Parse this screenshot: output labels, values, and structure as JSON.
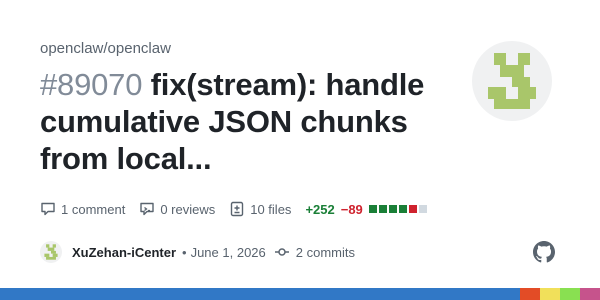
{
  "repo": "openclaw/openclaw",
  "pr": {
    "number": "#89070",
    "title": "fix(stream): handle cumulative JSON chunks from local..."
  },
  "stats": {
    "comments": "1 comment",
    "reviews": "0 reviews",
    "files": "10 files",
    "additions": "+252",
    "deletions": "−89",
    "diff_squares": [
      "#1a7f37",
      "#1a7f37",
      "#1a7f37",
      "#1a7f37",
      "#cf222e",
      "#d1d9e0"
    ]
  },
  "meta": {
    "author": "XuZehan-iCenter",
    "separator": "•",
    "date": "June 1, 2026",
    "commits": "2 commits"
  },
  "icons": {
    "comment": "comment-icon",
    "review": "review-icon",
    "file_diff": "file-diff-icon",
    "commit": "git-commit-icon",
    "github": "github-mark-icon"
  },
  "colors": {
    "accent_green": "#1a7f37",
    "accent_red": "#cf222e",
    "avatar_green": "#a9c66a",
    "language_bar": [
      "#3178c6",
      "#3178c6",
      "#3178c6",
      "#e34c26",
      "#f1e05a",
      "#89e051",
      "#c6538c"
    ]
  }
}
